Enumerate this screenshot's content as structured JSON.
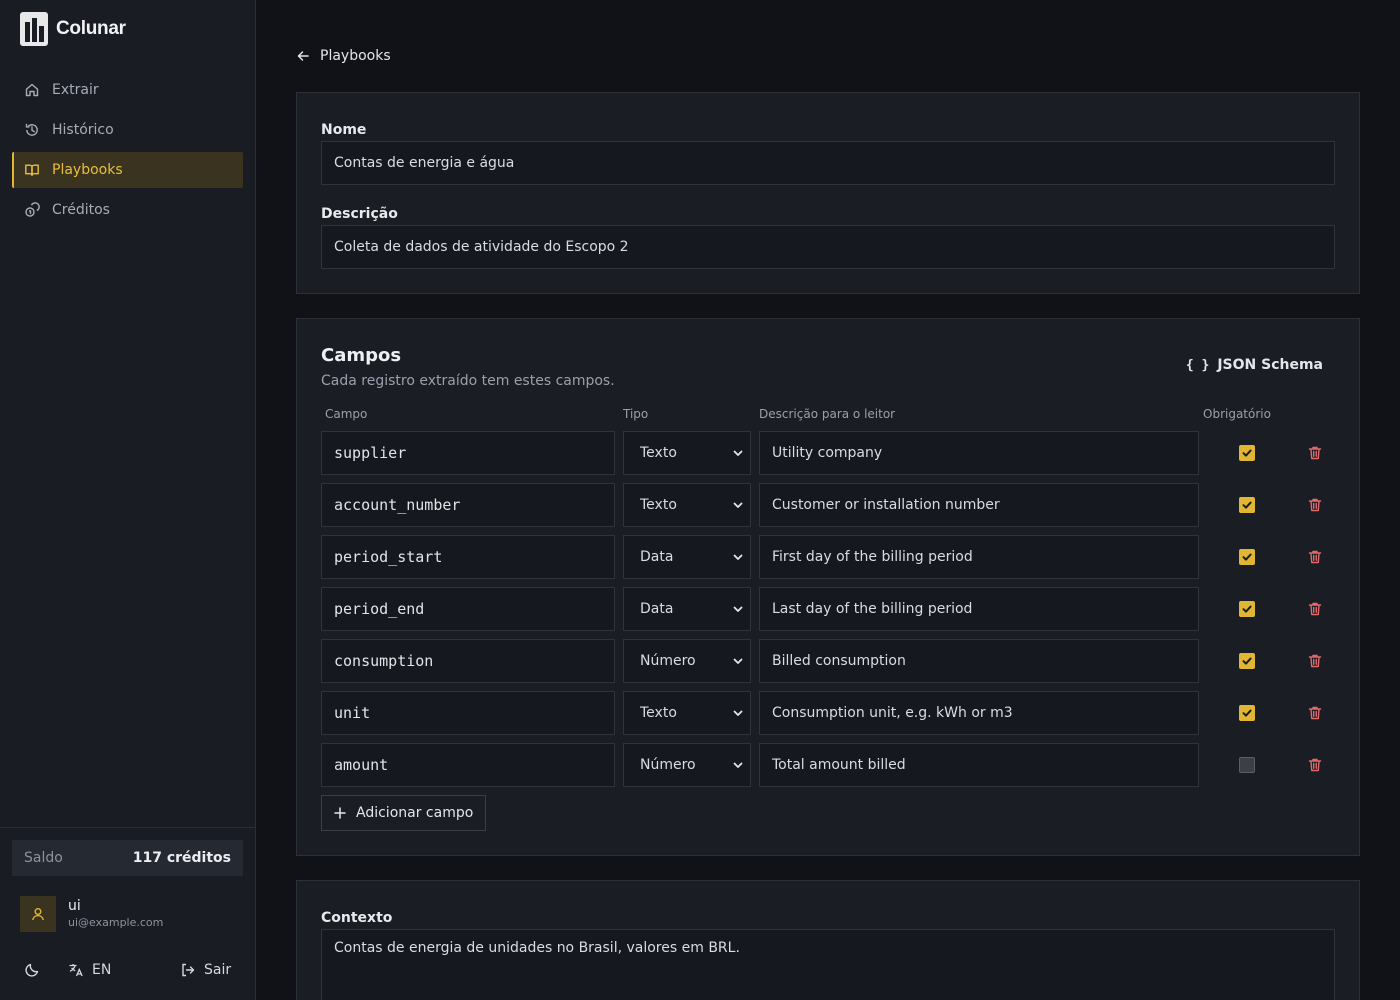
{
  "app": {
    "name": "Colunar"
  },
  "sidebar": {
    "items": [
      {
        "label": "Extrair",
        "icon": "home-icon"
      },
      {
        "label": "Histórico",
        "icon": "history-icon"
      },
      {
        "label": "Playbooks",
        "icon": "book-icon",
        "active": true
      },
      {
        "label": "Créditos",
        "icon": "coins-icon"
      }
    ],
    "balance_label": "Saldo",
    "balance_value": "117 créditos",
    "user": {
      "name": "ui",
      "email": "ui@example.com"
    },
    "language": "EN",
    "logout_label": "Sair"
  },
  "main": {
    "back_label": "Playbooks",
    "name_label": "Nome",
    "name_value": "Contas de energia e água",
    "description_label": "Descrição",
    "description_value": "Coleta de dados de atividade do Escopo 2",
    "fields_title": "Campos",
    "fields_subtitle": "Cada registro extraído tem estes campos.",
    "schema_button": "JSON Schema",
    "columns": {
      "field": "Campo",
      "type": "Tipo",
      "desc": "Descrição para o leitor",
      "required": "Obrigatório"
    },
    "fields": [
      {
        "name": "supplier",
        "type": "Texto",
        "desc": "Utility company",
        "required": true
      },
      {
        "name": "account_number",
        "type": "Texto",
        "desc": "Customer or installation number",
        "required": true
      },
      {
        "name": "period_start",
        "type": "Data",
        "desc": "First day of the billing period",
        "required": true
      },
      {
        "name": "period_end",
        "type": "Data",
        "desc": "Last day of the billing period",
        "required": true
      },
      {
        "name": "consumption",
        "type": "Número",
        "desc": "Billed consumption",
        "required": true
      },
      {
        "name": "unit",
        "type": "Texto",
        "desc": "Consumption unit, e.g. kWh or m3",
        "required": true
      },
      {
        "name": "amount",
        "type": "Número",
        "desc": "Total amount billed",
        "required": false
      }
    ],
    "add_field_label": "Adicionar campo",
    "context_label": "Contexto",
    "context_value": "Contas de energia de unidades no Brasil, valores em BRL."
  },
  "colors": {
    "accent": "#e0b634",
    "danger": "#e06a6a",
    "background": "#101217",
    "panel": "#1a1d24"
  }
}
